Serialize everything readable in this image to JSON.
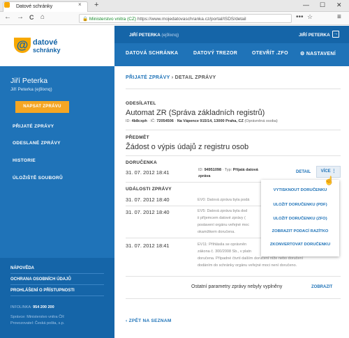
{
  "browser": {
    "tab_title": "Datové schránky",
    "tab_close": "×",
    "new_tab": "+",
    "win_min": "—",
    "win_max": "☐",
    "win_close": "✕",
    "ssl_label": "Ministerstvo vnitra (CZ)",
    "url": "https://www.mojedatovaschranka.cz/portal/ISDS/detail",
    "url_dots": "•••",
    "back_icon": "←",
    "forward_icon": "→",
    "reload_icon": "C",
    "home_icon": "⌂",
    "star_icon": "☆",
    "menu_icon": "≡"
  },
  "header": {
    "user_top": "JIŘÍ PETERKA",
    "user_top_id": "(ej9ixnq)",
    "user_right": "JIŘÍ PETERKA",
    "logo_mark": "@",
    "logo_line1": "datové",
    "logo_line2": "schránky",
    "nav": [
      {
        "label": "DATOVÁ SCHRÁNKA"
      },
      {
        "label": "DATOVÝ TREZOR"
      },
      {
        "label": "OTEVŘÍT .ZFO"
      },
      {
        "label": "NASTAVENÍ"
      }
    ]
  },
  "sidebar": {
    "name": "Jiří Peterka",
    "sub": "Jiří Peterka (ej9ixnq)",
    "new_message": "NAPSAT ZPRÁVU",
    "items": [
      {
        "label": "PŘIJATÉ ZPRÁVY"
      },
      {
        "label": "ODESLANÉ ZPRÁVY"
      },
      {
        "label": "HISTORIE"
      },
      {
        "label": "ÚLOŽIŠTĚ SOUBORŮ"
      }
    ],
    "footer_links": [
      {
        "label": "NÁPOVĚDA"
      },
      {
        "label": "OCHRANA OSOBNÍCH ÚDAJŮ"
      },
      {
        "label": "PROHLÁŠENÍ O PŘÍSTUPNOSTI"
      }
    ],
    "infolinka_label": "INFOLINKA:",
    "infolinka_number": "954 200 200",
    "spravce": "Správce: Ministerstvo vnitra ČR",
    "provozovatel": "Provozovatel: Česká pošta, s.p."
  },
  "content": {
    "crumb_link": "PŘIJATÉ ZPRÁVY",
    "crumb_sep": "›",
    "crumb_current": "DETAIL ZPRÁVY",
    "odesilatel_label": "ODESÍLATEL",
    "odesilatel_name": "Automat ZR (Správa základních registrů)",
    "odesilatel_id_label": "ID:",
    "odesilatel_id": "4b8cxph",
    "odesilatel_ic_label": "· IČ:",
    "odesilatel_ic": "72054506",
    "odesilatel_addr": "Na Vápence 915/14, 13000 Praha, CZ",
    "odesilatel_note": "(Oprávněná osoba)",
    "predmet_label": "PŘEDMĚT",
    "predmet": "Žádost o výpis údajů z registru osob",
    "dorucenka_label": "DORUČENKA",
    "dorucenka_date": "31. 07. 2012 18:41",
    "dorucenka_id_label": "ID:",
    "dorucenka_id": "94951098",
    "dorucenka_typ_label": "· Typ:",
    "dorucenka_typ": "Přijatá datová zpráva",
    "detail_btn": "DETAIL",
    "vice_btn": "VÍCE ⋮",
    "cursor_icon": "☝",
    "dropdown": [
      {
        "label": "VYTISKNOUT DORUČENKU"
      },
      {
        "label": "ULOŽIT DORUČENKU (PDF)"
      },
      {
        "label": "ULOŽIT DORUČENKU (ZFO)"
      },
      {
        "label": "ZOBRAZIT PODACÍ RAZÍTKO"
      },
      {
        "label": "ZKONVERTOVAT DORUČENKU"
      }
    ],
    "udalosti_label": "UDÁLOSTI ZPRÁVY",
    "events": [
      {
        "date": "31. 07. 2012 18:40",
        "lines": [
          "EV0: Datová zpráva byla podá"
        ]
      },
      {
        "date": "31. 07. 2012 18:40",
        "lines": [
          "EV5: Datová zpráva byla dod",
          "ii příjemcem datové zprávy (",
          "postavení orgánu veřejné moc",
          "okamžikem doručena."
        ]
      },
      {
        "date": "31. 07. 2012 18:41",
        "lines": [
          "EV11: Přihlásila se oprávněn",
          "zákona č. 300/2008 Sb., v platn",
          "doručena. Případné čtvrtí dalším doručení níže nebo doručení",
          "dodáním do schránky orgánu veřejné moci není doručeno."
        ]
      }
    ],
    "ostatni": "Ostatní parametry zprávy nebyly vyplněny",
    "zobrazit": "ZOBRAZIT",
    "back_link": "ZPĚT NA SEZNAM"
  }
}
